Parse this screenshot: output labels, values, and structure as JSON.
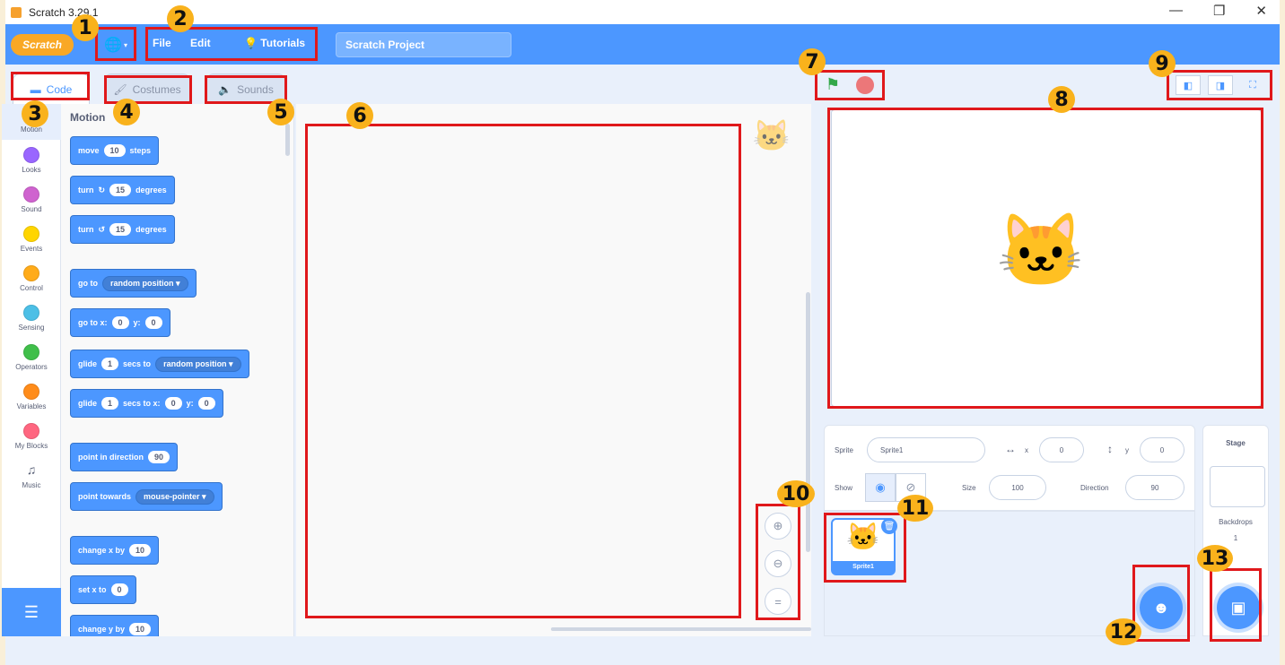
{
  "window": {
    "title": "Scratch 3.29.1",
    "controls": [
      "—",
      "❐",
      "✕"
    ]
  },
  "menubar": {
    "logo": "Scratch",
    "language_icon": "globe-icon",
    "file": "File",
    "edit": "Edit",
    "tutorials": "Tutorials",
    "project_title": "Scratch Project"
  },
  "tabs": {
    "code": "Code",
    "costumes": "Costumes",
    "sounds": "Sounds"
  },
  "categories": [
    {
      "label": "Motion",
      "color": "#4c97ff"
    },
    {
      "label": "Looks",
      "color": "#9966ff"
    },
    {
      "label": "Sound",
      "color": "#cf63cf"
    },
    {
      "label": "Events",
      "color": "#ffd500"
    },
    {
      "label": "Control",
      "color": "#ffab19"
    },
    {
      "label": "Sensing",
      "color": "#4cbfe6"
    },
    {
      "label": "Operators",
      "color": "#40bf4a"
    },
    {
      "label": "Variables",
      "color": "#ff8c1a"
    },
    {
      "label": "My Blocks",
      "color": "#ff6680"
    },
    {
      "label": "Music",
      "color": ""
    }
  ],
  "palette": {
    "title": "Motion",
    "blocks": {
      "move": {
        "pre": "move",
        "val": "10",
        "post": "steps"
      },
      "turn_right": {
        "pre": "turn",
        "icon": "↻",
        "val": "15",
        "post": "degrees"
      },
      "turn_left": {
        "pre": "turn",
        "icon": "↺",
        "val": "15",
        "post": "degrees"
      },
      "goto": {
        "pre": "go to",
        "drop": "random position ▾"
      },
      "gotoxy": {
        "pre": "go to x:",
        "x": "0",
        "ylabel": "y:",
        "y": "0"
      },
      "glide_to": {
        "pre": "glide",
        "val": "1",
        "mid": "secs to",
        "drop": "random position ▾"
      },
      "glide_xy": {
        "pre": "glide",
        "val": "1",
        "mid": "secs to x:",
        "x": "0",
        "ylabel": "y:",
        "y": "0"
      },
      "point_dir": {
        "pre": "point in direction",
        "val": "90"
      },
      "point_towards": {
        "pre": "point towards",
        "drop": "mouse-pointer ▾"
      },
      "change_x": {
        "pre": "change x by",
        "val": "10"
      },
      "set_x": {
        "pre": "set x to",
        "val": "0"
      },
      "change_y": {
        "pre": "change y by",
        "val": "10"
      }
    }
  },
  "stage_info": {
    "sprite_label": "Sprite",
    "sprite_name": "Sprite1",
    "x_label": "x",
    "x_value": "0",
    "y_label": "y",
    "y_value": "0",
    "show_label": "Show",
    "size_label": "Size",
    "size_value": "100",
    "direction_label": "Direction",
    "direction_value": "90"
  },
  "sprite_tile": {
    "name": "Sprite1"
  },
  "stage_panel": {
    "title": "Stage",
    "backdrops_label": "Backdrops",
    "backdrops_count": "1"
  },
  "annotations": [
    "1",
    "2",
    "3",
    "4",
    "5",
    "6",
    "7",
    "8",
    "9",
    "10",
    "11",
    "12",
    "13"
  ],
  "colors": {
    "accent": "#4c97ff",
    "annotation_red": "#e0181b",
    "badge_yellow": "#f9b21c"
  }
}
